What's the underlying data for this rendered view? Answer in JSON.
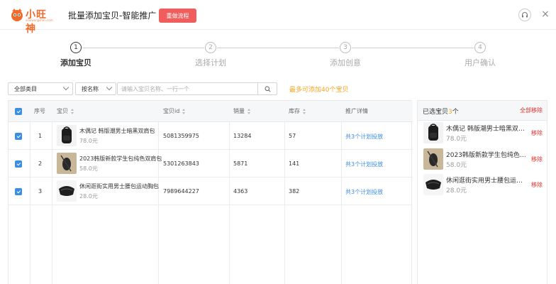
{
  "header": {
    "logo_text": "小旺神",
    "logo_sub": "xiaowangshen.com",
    "title": "批量添加宝贝-智能推广",
    "redo_label": "重做流程"
  },
  "steps": [
    {
      "num": "1",
      "label": "添加宝贝",
      "active": true
    },
    {
      "num": "2",
      "label": "选择计划",
      "active": false
    },
    {
      "num": "3",
      "label": "添加创意",
      "active": false
    },
    {
      "num": "4",
      "label": "用户确认",
      "active": false
    }
  ],
  "filter": {
    "category_value": "全部类目",
    "search_by_value": "按名称",
    "search_placeholder": "请输入宝贝名称、一行一个",
    "max_note": "最多可添加40个宝贝"
  },
  "table": {
    "headers": {
      "index": "序号",
      "item": "宝贝",
      "item_id": "宝贝id",
      "sales": "销量",
      "stock": "库存",
      "detail": "推广详情"
    },
    "rows": [
      {
        "index": "1",
        "name": "木偶记 韩版潮男士暗黑双肩包",
        "price": "78.0元",
        "item_id": "5081359975",
        "sales": "13284",
        "stock": "57",
        "detail": "共3个计划投放"
      },
      {
        "index": "2",
        "name": "2023韩版新款学生包纯色双肩包",
        "price": "58.0元",
        "item_id": "5301263843",
        "sales": "5871",
        "stock": "141",
        "detail": "共3个计划投放"
      },
      {
        "index": "3",
        "name": "休闲逛街实用男士腰包运动胸包",
        "price": "28.0元",
        "item_id": "7989644227",
        "sales": "4363",
        "stock": "382",
        "detail": "共3个计划投放"
      }
    ]
  },
  "panel": {
    "title_prefix": "已选宝贝",
    "count": "3",
    "title_suffix": "个",
    "remove_all": "全部移除",
    "remove_label": "移除",
    "items": [
      {
        "name": "木偶记 韩版潮男士暗黑双肩包",
        "price": "78.0元"
      },
      {
        "name": "2023韩版新款学生包纯色双肩包",
        "price": "58.0元"
      },
      {
        "name": "休闲逛街实用男士腰包运动胸包",
        "price": "28.0元"
      }
    ]
  },
  "colors": {
    "accent": "#3a8ee6",
    "brand": "#f06a2b",
    "warning": "#f5a623",
    "danger": "#e0312d",
    "redo_button": "#f05d5d"
  }
}
